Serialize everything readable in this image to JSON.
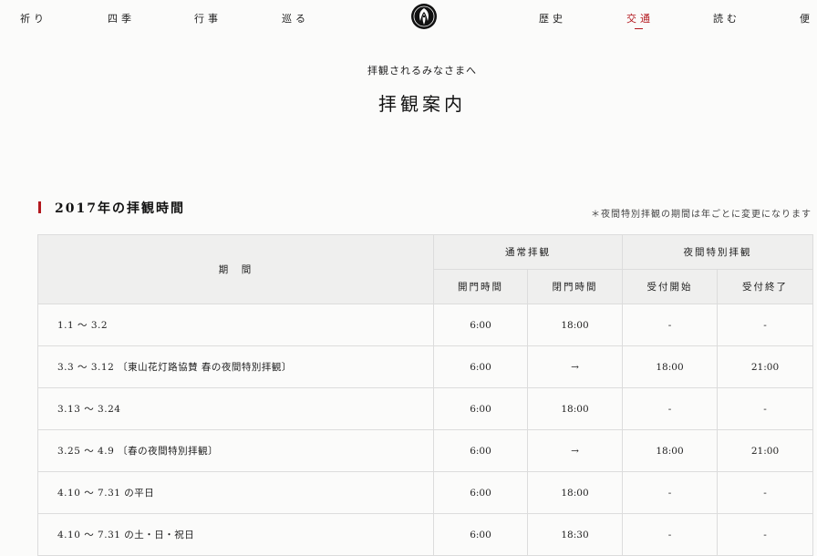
{
  "nav": {
    "left": [
      "祈り",
      "四季",
      "行事",
      "巡る"
    ],
    "right": [
      "歴史",
      "交通",
      "読む",
      "便"
    ],
    "active": "交通",
    "crest_icon": "temple-crest-icon"
  },
  "page": {
    "subtitle": "拝観されるみなさまへ",
    "title": "拝観案内"
  },
  "section": {
    "title": "2017年の拝観時間",
    "note": "＊夜間特別拝観の期間は年ごとに変更になります"
  },
  "table": {
    "head": {
      "period": "期　間",
      "normal": "通常拝観",
      "night": "夜間特別拝観",
      "open": "開門時間",
      "close": "閉門時間",
      "start": "受付開始",
      "end": "受付終了"
    },
    "rows": [
      {
        "period": "1.1 ～ 3.2",
        "open": "6:00",
        "close": "18:00",
        "start": "-",
        "end": "-"
      },
      {
        "period": "3.3 ～ 3.12 〔東山花灯路協賛 春の夜間特別拝観〕",
        "open": "6:00",
        "close": "→",
        "start": "18:00",
        "end": "21:00"
      },
      {
        "period": "3.13 ～ 3.24",
        "open": "6:00",
        "close": "18:00",
        "start": "-",
        "end": "-"
      },
      {
        "period": "3.25 ～ 4.9 〔春の夜間特別拝観〕",
        "open": "6:00",
        "close": "→",
        "start": "18:00",
        "end": "21:00"
      },
      {
        "period": "4.10 ～ 7.31 の平日",
        "open": "6:00",
        "close": "18:00",
        "start": "-",
        "end": "-"
      },
      {
        "period": "4.10 ～ 7.31 の土・日・祝日",
        "open": "6:00",
        "close": "18:30",
        "start": "-",
        "end": "-"
      }
    ]
  },
  "colors": {
    "accent": "#b3181e",
    "header_bg": "#efefee",
    "page_bg": "#fbfbfa"
  }
}
